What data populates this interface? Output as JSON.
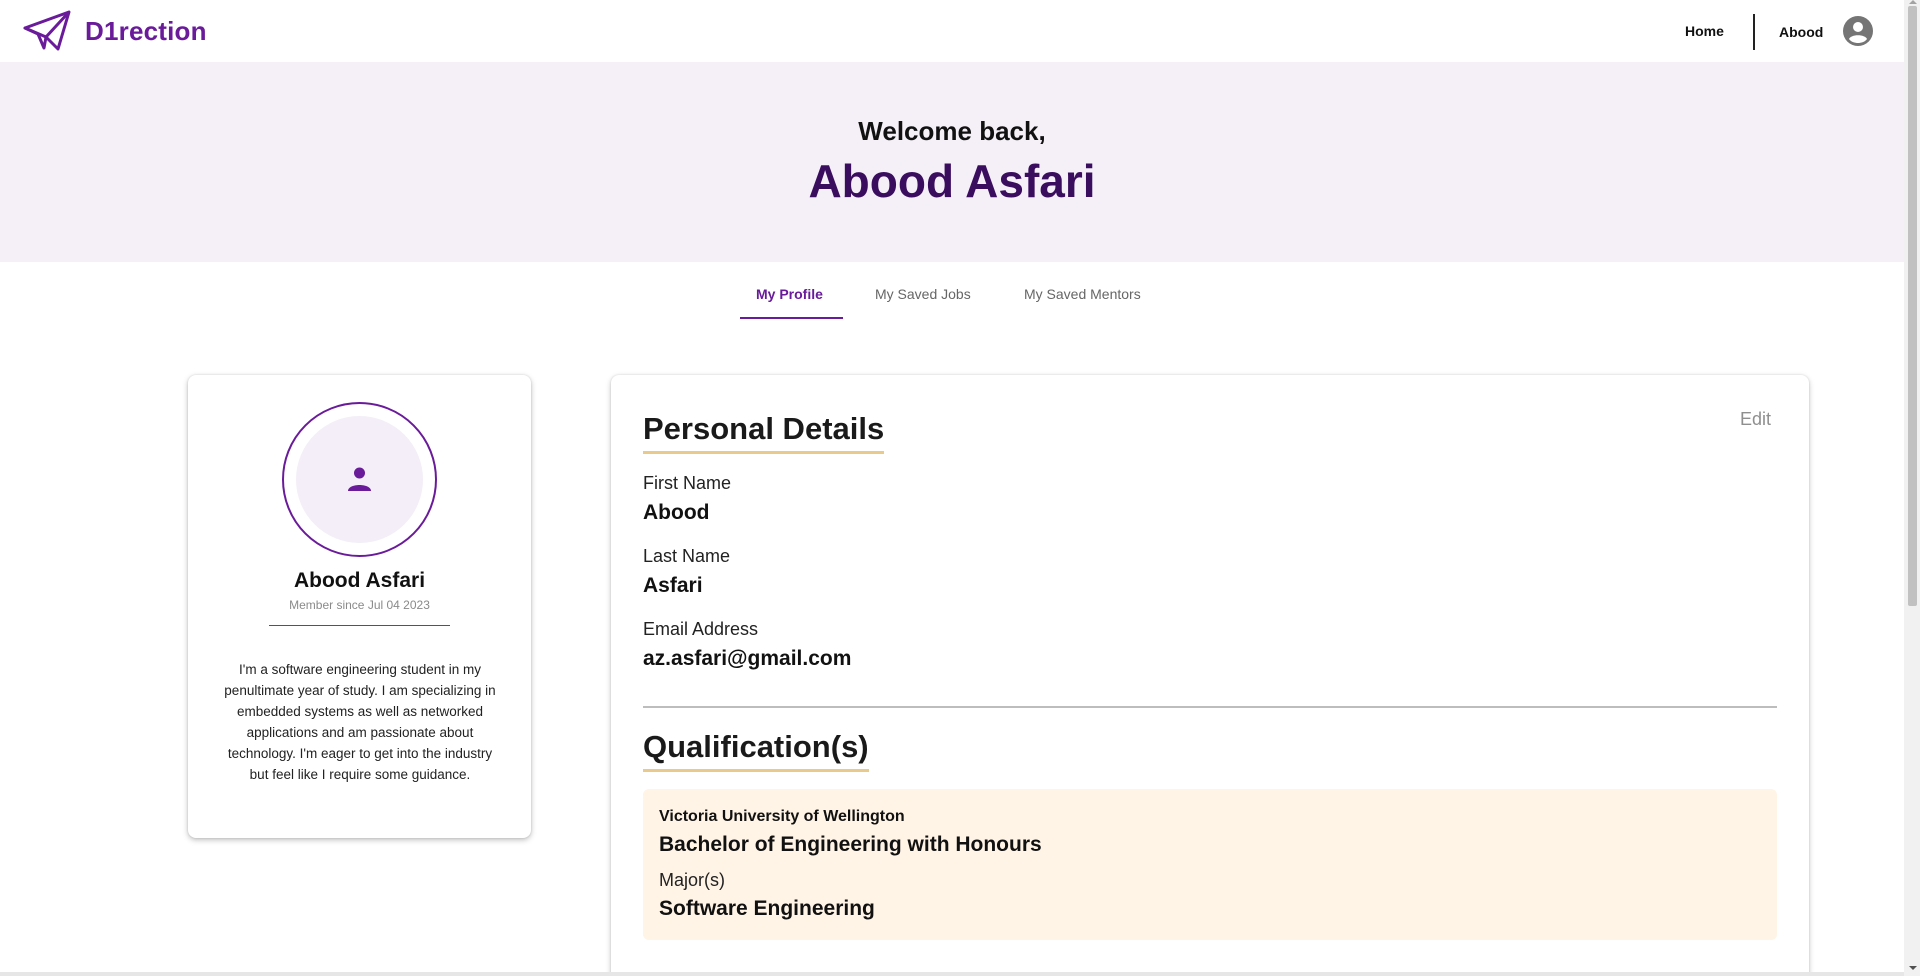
{
  "nav": {
    "brand": "D1rection",
    "home": "Home",
    "user": "Abood"
  },
  "hero": {
    "welcome": "Welcome back,",
    "name": "Abood Asfari"
  },
  "tabs": [
    {
      "label": "My Profile",
      "active": true
    },
    {
      "label": "My Saved Jobs",
      "active": false
    },
    {
      "label": "My Saved Mentors",
      "active": false
    }
  ],
  "profile": {
    "name": "Abood Asfari",
    "member_since": "Member since Jul 04 2023",
    "bio": "I'm a software engineering student in my penultimate year of study. I am specializing in embedded systems as well as networked applications and am passionate about technology. I'm eager to get into the industry but feel like I require some guidance."
  },
  "details": {
    "title": "Personal Details",
    "edit": "Edit",
    "fields": [
      {
        "label": "First Name",
        "value": "Abood"
      },
      {
        "label": "Last Name",
        "value": "Asfari"
      },
      {
        "label": "Email Address",
        "value": "az.asfari@gmail.com"
      }
    ]
  },
  "qualifications": {
    "title": "Qualification(s)",
    "items": [
      {
        "university": "Victoria University of Wellington",
        "degree": "Bachelor of Engineering with Honours",
        "major_label": "Major(s)",
        "major": "Software Engineering"
      }
    ]
  },
  "colors": {
    "brand": "#6a1b9a",
    "hero_bg": "#f5f0f8",
    "hero_name": "#3a0d5e",
    "accent_underline": "#e9c98c",
    "qualification_bg": "#fff4e6"
  },
  "icons": {
    "logo": "paper-plane-icon",
    "account": "account-circle-icon",
    "profile_picture": "person-icon"
  }
}
